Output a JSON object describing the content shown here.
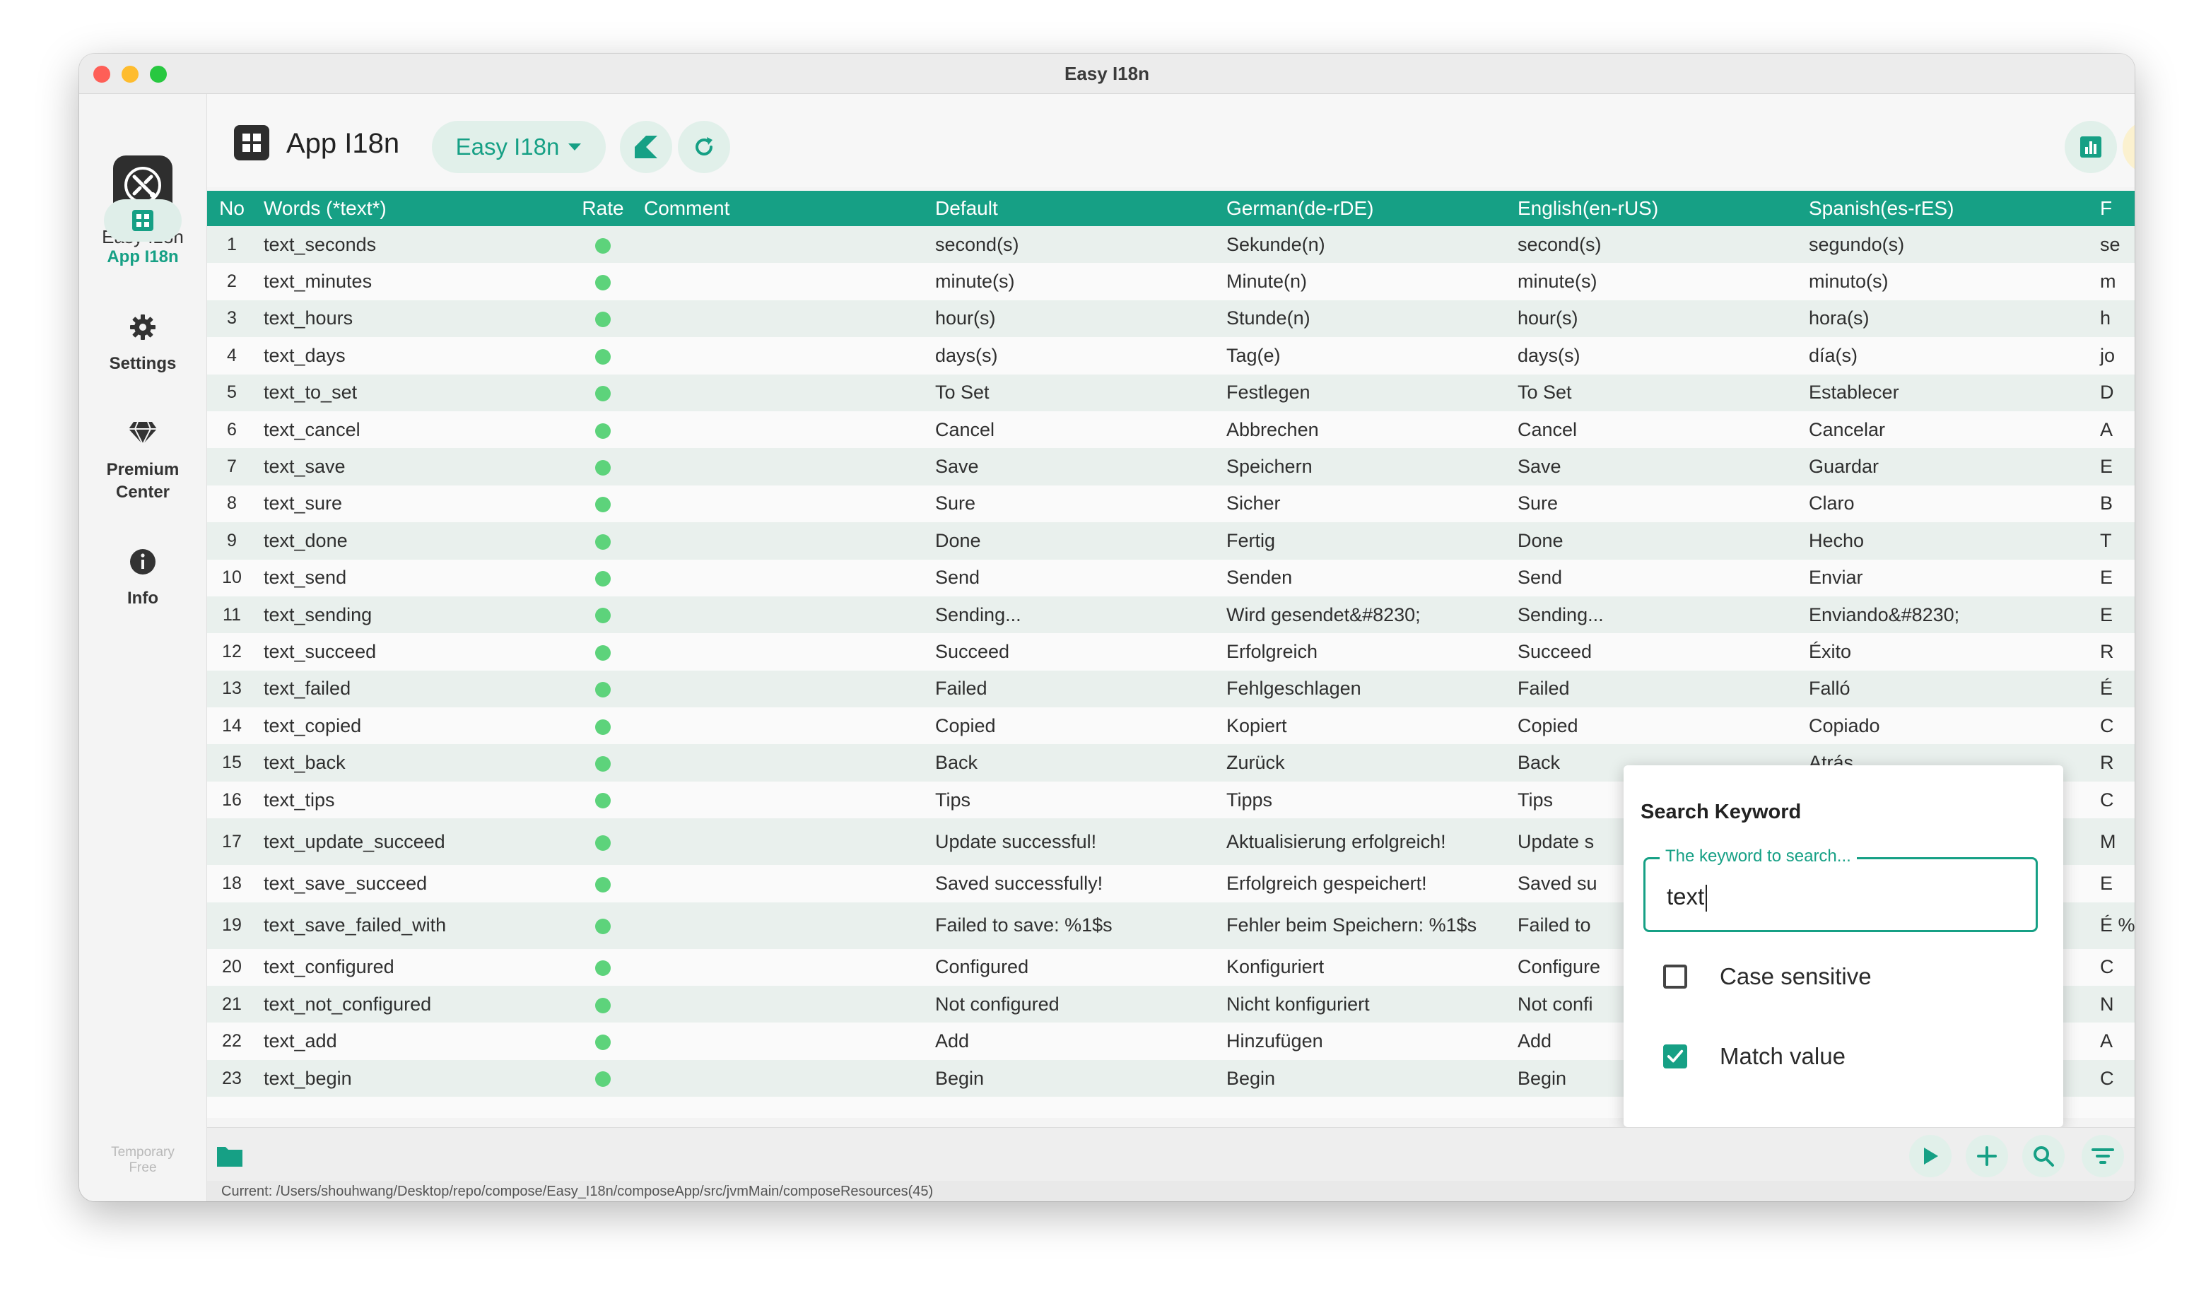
{
  "window": {
    "title": "Easy I18n"
  },
  "sidebar": {
    "app_name": "Easy I18n",
    "items": [
      {
        "label": "App I18n",
        "icon": "grid-icon",
        "active": true
      },
      {
        "label": "Settings",
        "icon": "gear-icon"
      },
      {
        "label": "Premium Center",
        "icon": "diamond-icon"
      },
      {
        "label": "Info",
        "icon": "info-icon"
      }
    ],
    "license": "Temporary Free"
  },
  "header": {
    "title": "App I18n",
    "project_selector": "Easy I18n"
  },
  "table": {
    "columns": [
      "No",
      "Words (*text*)",
      "Rate",
      "Comment",
      "Default",
      "German(de-rDE)",
      "English(en-rUS)",
      "Spanish(es-rES)",
      "F"
    ],
    "rows": [
      [
        "1",
        "text_seconds",
        "",
        "second(s)",
        "Sekunde(n)",
        "second(s)",
        "segundo(s)",
        "se"
      ],
      [
        "2",
        "text_minutes",
        "",
        "minute(s)",
        "Minute(n)",
        "minute(s)",
        "minuto(s)",
        "m"
      ],
      [
        "3",
        "text_hours",
        "",
        "hour(s)",
        "Stunde(n)",
        "hour(s)",
        "hora(s)",
        "h"
      ],
      [
        "4",
        "text_days",
        "",
        "days(s)",
        "Tag(e)",
        "days(s)",
        "día(s)",
        "jo"
      ],
      [
        "5",
        "text_to_set",
        "",
        "To Set",
        "Festlegen",
        "To Set",
        "Establecer",
        "D"
      ],
      [
        "6",
        "text_cancel",
        "",
        "Cancel",
        "Abbrechen",
        "Cancel",
        "Cancelar",
        "A"
      ],
      [
        "7",
        "text_save",
        "",
        "Save",
        "Speichern",
        "Save",
        "Guardar",
        "E"
      ],
      [
        "8",
        "text_sure",
        "",
        "Sure",
        "Sicher",
        "Sure",
        "Claro",
        "B"
      ],
      [
        "9",
        "text_done",
        "",
        "Done",
        "Fertig",
        "Done",
        "Hecho",
        "T"
      ],
      [
        "10",
        "text_send",
        "",
        "Send",
        "Senden",
        "Send",
        "Enviar",
        "E"
      ],
      [
        "11",
        "text_sending",
        "",
        "Sending...",
        "Wird gesendet&#8230;",
        "Sending...",
        "Enviando&#8230;",
        "E"
      ],
      [
        "12",
        "text_succeed",
        "",
        "Succeed",
        "Erfolgreich",
        "Succeed",
        "Éxito",
        "R"
      ],
      [
        "13",
        "text_failed",
        "",
        "Failed",
        "Fehlgeschlagen",
        "Failed",
        "Falló",
        "É"
      ],
      [
        "14",
        "text_copied",
        "",
        "Copied",
        "Kopiert",
        "Copied",
        "Copiado",
        "C"
      ],
      [
        "15",
        "text_back",
        "",
        "Back",
        "Zurück",
        "Back",
        "Atrás",
        "R"
      ],
      [
        "16",
        "text_tips",
        "",
        "Tips",
        "Tipps",
        "Tips",
        "",
        "C"
      ],
      [
        "17",
        "text_update_succeed",
        "",
        "Update successful!",
        "Aktualisierung erfolgreich!",
        "Update s",
        "",
        "M"
      ],
      [
        "18",
        "text_save_succeed",
        "",
        "Saved successfully!",
        "Erfolgreich gespeichert!",
        "Saved su",
        "",
        "E"
      ],
      [
        "19",
        "text_save_failed_with",
        "",
        "Failed to save: %1$s",
        "Fehler beim Speichern: %1$s",
        "Failed to",
        "",
        "É %"
      ],
      [
        "20",
        "text_configured",
        "",
        "Configured",
        "Konfiguriert",
        "Configure",
        "",
        "C"
      ],
      [
        "21",
        "text_not_configured",
        "",
        "Not configured",
        "Nicht konfiguriert",
        "Not confi",
        "",
        "N"
      ],
      [
        "22",
        "text_add",
        "",
        "Add",
        "Hinzufügen",
        "Add",
        "",
        "A"
      ],
      [
        "23",
        "text_begin",
        "",
        "Begin",
        "Begin",
        "Begin",
        "",
        "C"
      ]
    ]
  },
  "search": {
    "title": "Search Keyword",
    "field_label": "The keyword to search...",
    "value": "text",
    "case_sensitive_label": "Case sensitive",
    "case_sensitive": false,
    "match_value_label": "Match value",
    "match_value": true
  },
  "status": {
    "path": "Current: /Users/shouhwang/Desktop/repo/compose/Easy_I18n/composeApp/src/jvmMain/composeResources(45)"
  },
  "colors": {
    "accent": "#16a085",
    "rate_dot": "#5dd37b",
    "row_alt": "#e9f0ed"
  }
}
